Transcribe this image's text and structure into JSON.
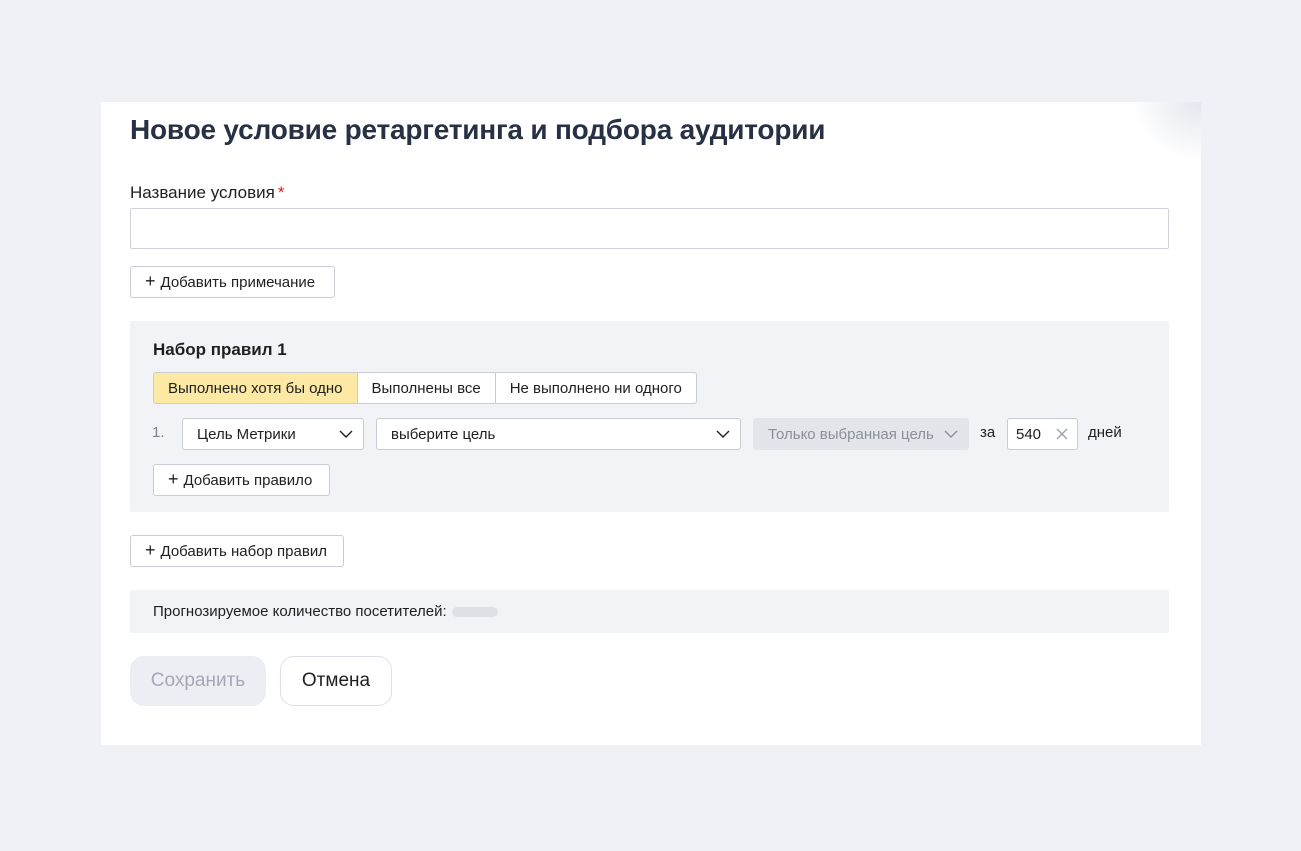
{
  "dialog": {
    "title": "Новое условие ретаргетинга и подбора аудитории",
    "name_label": "Название условия",
    "required_mark": "*",
    "name_value": "",
    "add_note_label": "Добавить примечание"
  },
  "ruleset": {
    "title": "Набор правил 1",
    "modes": [
      {
        "label": "Выполнено хотя бы одно",
        "active": true
      },
      {
        "label": "Выполнены все",
        "active": false
      },
      {
        "label": "Не выполнено ни одного",
        "active": false
      }
    ],
    "rule": {
      "number": "1.",
      "type_value": "Цель Метрики",
      "goal_value": "выберите цель",
      "scope_value": "Только выбранная цель",
      "period_prefix": "за",
      "days_value": "540",
      "period_suffix": "дней"
    },
    "add_rule_label": "Добавить правило"
  },
  "add_ruleset_label": "Добавить набор правил",
  "forecast": {
    "label": "Прогнозируемое количество посетителей:"
  },
  "actions": {
    "save_label": "Сохранить",
    "cancel_label": "Отмена"
  },
  "colors": {
    "accent_active_segment": "#fde9a4",
    "required": "#e0201b",
    "page_background": "#eff1f6"
  },
  "icons": {
    "plus": "+",
    "chevron": "chevron-down-icon",
    "clear": "close-icon"
  }
}
